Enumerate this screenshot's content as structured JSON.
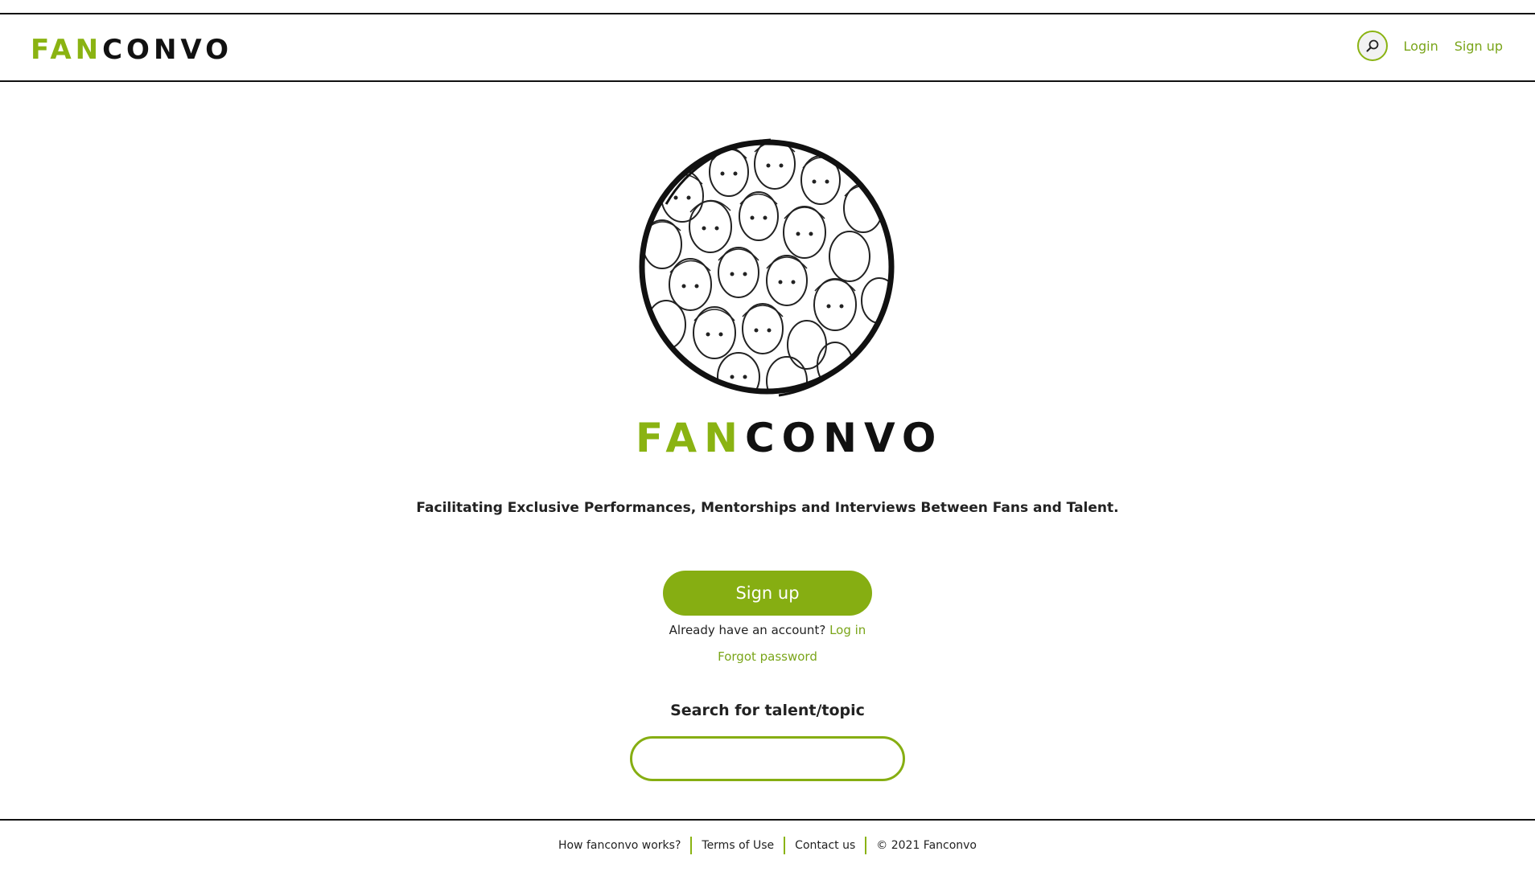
{
  "header": {
    "logo_fan": "FAN",
    "logo_convo": "CONVO",
    "login": "Login",
    "signup": "Sign up"
  },
  "hero": {
    "logo_fan": "FAN",
    "logo_convo": "CONVO",
    "tagline": "Facilitating Exclusive Performances, Mentorships and Interviews Between Fans and Talent."
  },
  "cta": {
    "signup_button": "Sign up",
    "account_prompt": "Already have an account?",
    "login_link": "Log in",
    "forgot_password": "Forgot password"
  },
  "search": {
    "label": "Search for talent/topic",
    "value": "",
    "placeholder": ""
  },
  "footer": {
    "links": [
      "How fanconvo works?",
      "Terms of Use",
      "Contact us"
    ],
    "copyright": "© 2021 Fanconvo"
  },
  "colors": {
    "brand_green": "#86ae12",
    "link_green": "#7aa51a",
    "text_dark": "#222222"
  },
  "icons": {
    "search": "magnifier-icon"
  }
}
